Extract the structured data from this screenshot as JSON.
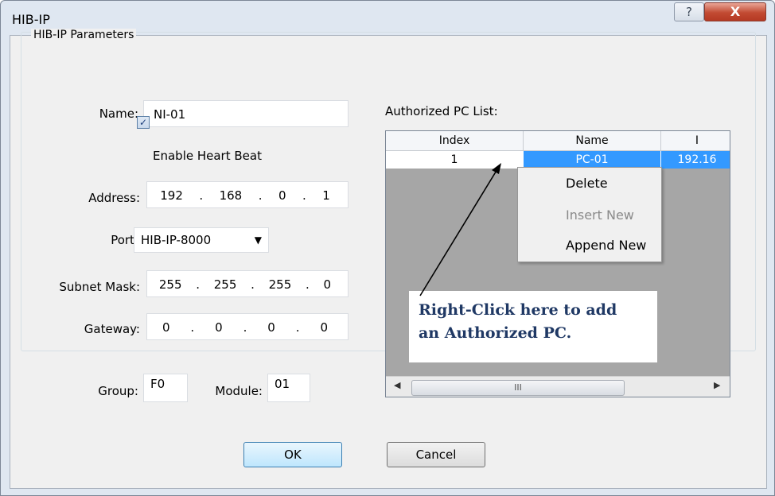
{
  "window": {
    "title": "HIB-IP",
    "help_glyph": "?",
    "close_glyph": "X"
  },
  "group": {
    "legend": "HIB-IP Parameters"
  },
  "form": {
    "name_label": "Name:",
    "name_value": "NI-01",
    "heartbeat_label": "Enable Heart Beat",
    "heartbeat_checked": true,
    "address_label": "Address:",
    "address": [
      "192",
      "168",
      "0",
      "1"
    ],
    "port_label": "Port:",
    "port_value": "HIB-IP-8000",
    "subnet_label": "Subnet Mask:",
    "subnet": [
      "255",
      "255",
      "255",
      "0"
    ],
    "gateway_label": "Gateway:",
    "gateway": [
      "0",
      "0",
      "0",
      "0"
    ],
    "group_label": "Group:",
    "group_value": "F0",
    "module_label": "Module:",
    "module_value": "01",
    "ip_dot": "."
  },
  "pc_list": {
    "label": "Authorized PC List:",
    "columns": [
      "Index",
      "Name",
      "I"
    ],
    "rows": [
      {
        "index": "1",
        "name": "PC-01",
        "ip": "192.16"
      }
    ],
    "scroll_thumb_glyph": "III"
  },
  "context_menu": {
    "items": [
      {
        "label": "Delete",
        "enabled": true
      },
      {
        "label": "Insert New",
        "enabled": false
      },
      {
        "label": "Append New",
        "enabled": true
      }
    ]
  },
  "annotation": {
    "line1": "Right-Click here to add",
    "line2": "an Authorized PC."
  },
  "buttons": {
    "ok": "OK",
    "cancel": "Cancel"
  }
}
